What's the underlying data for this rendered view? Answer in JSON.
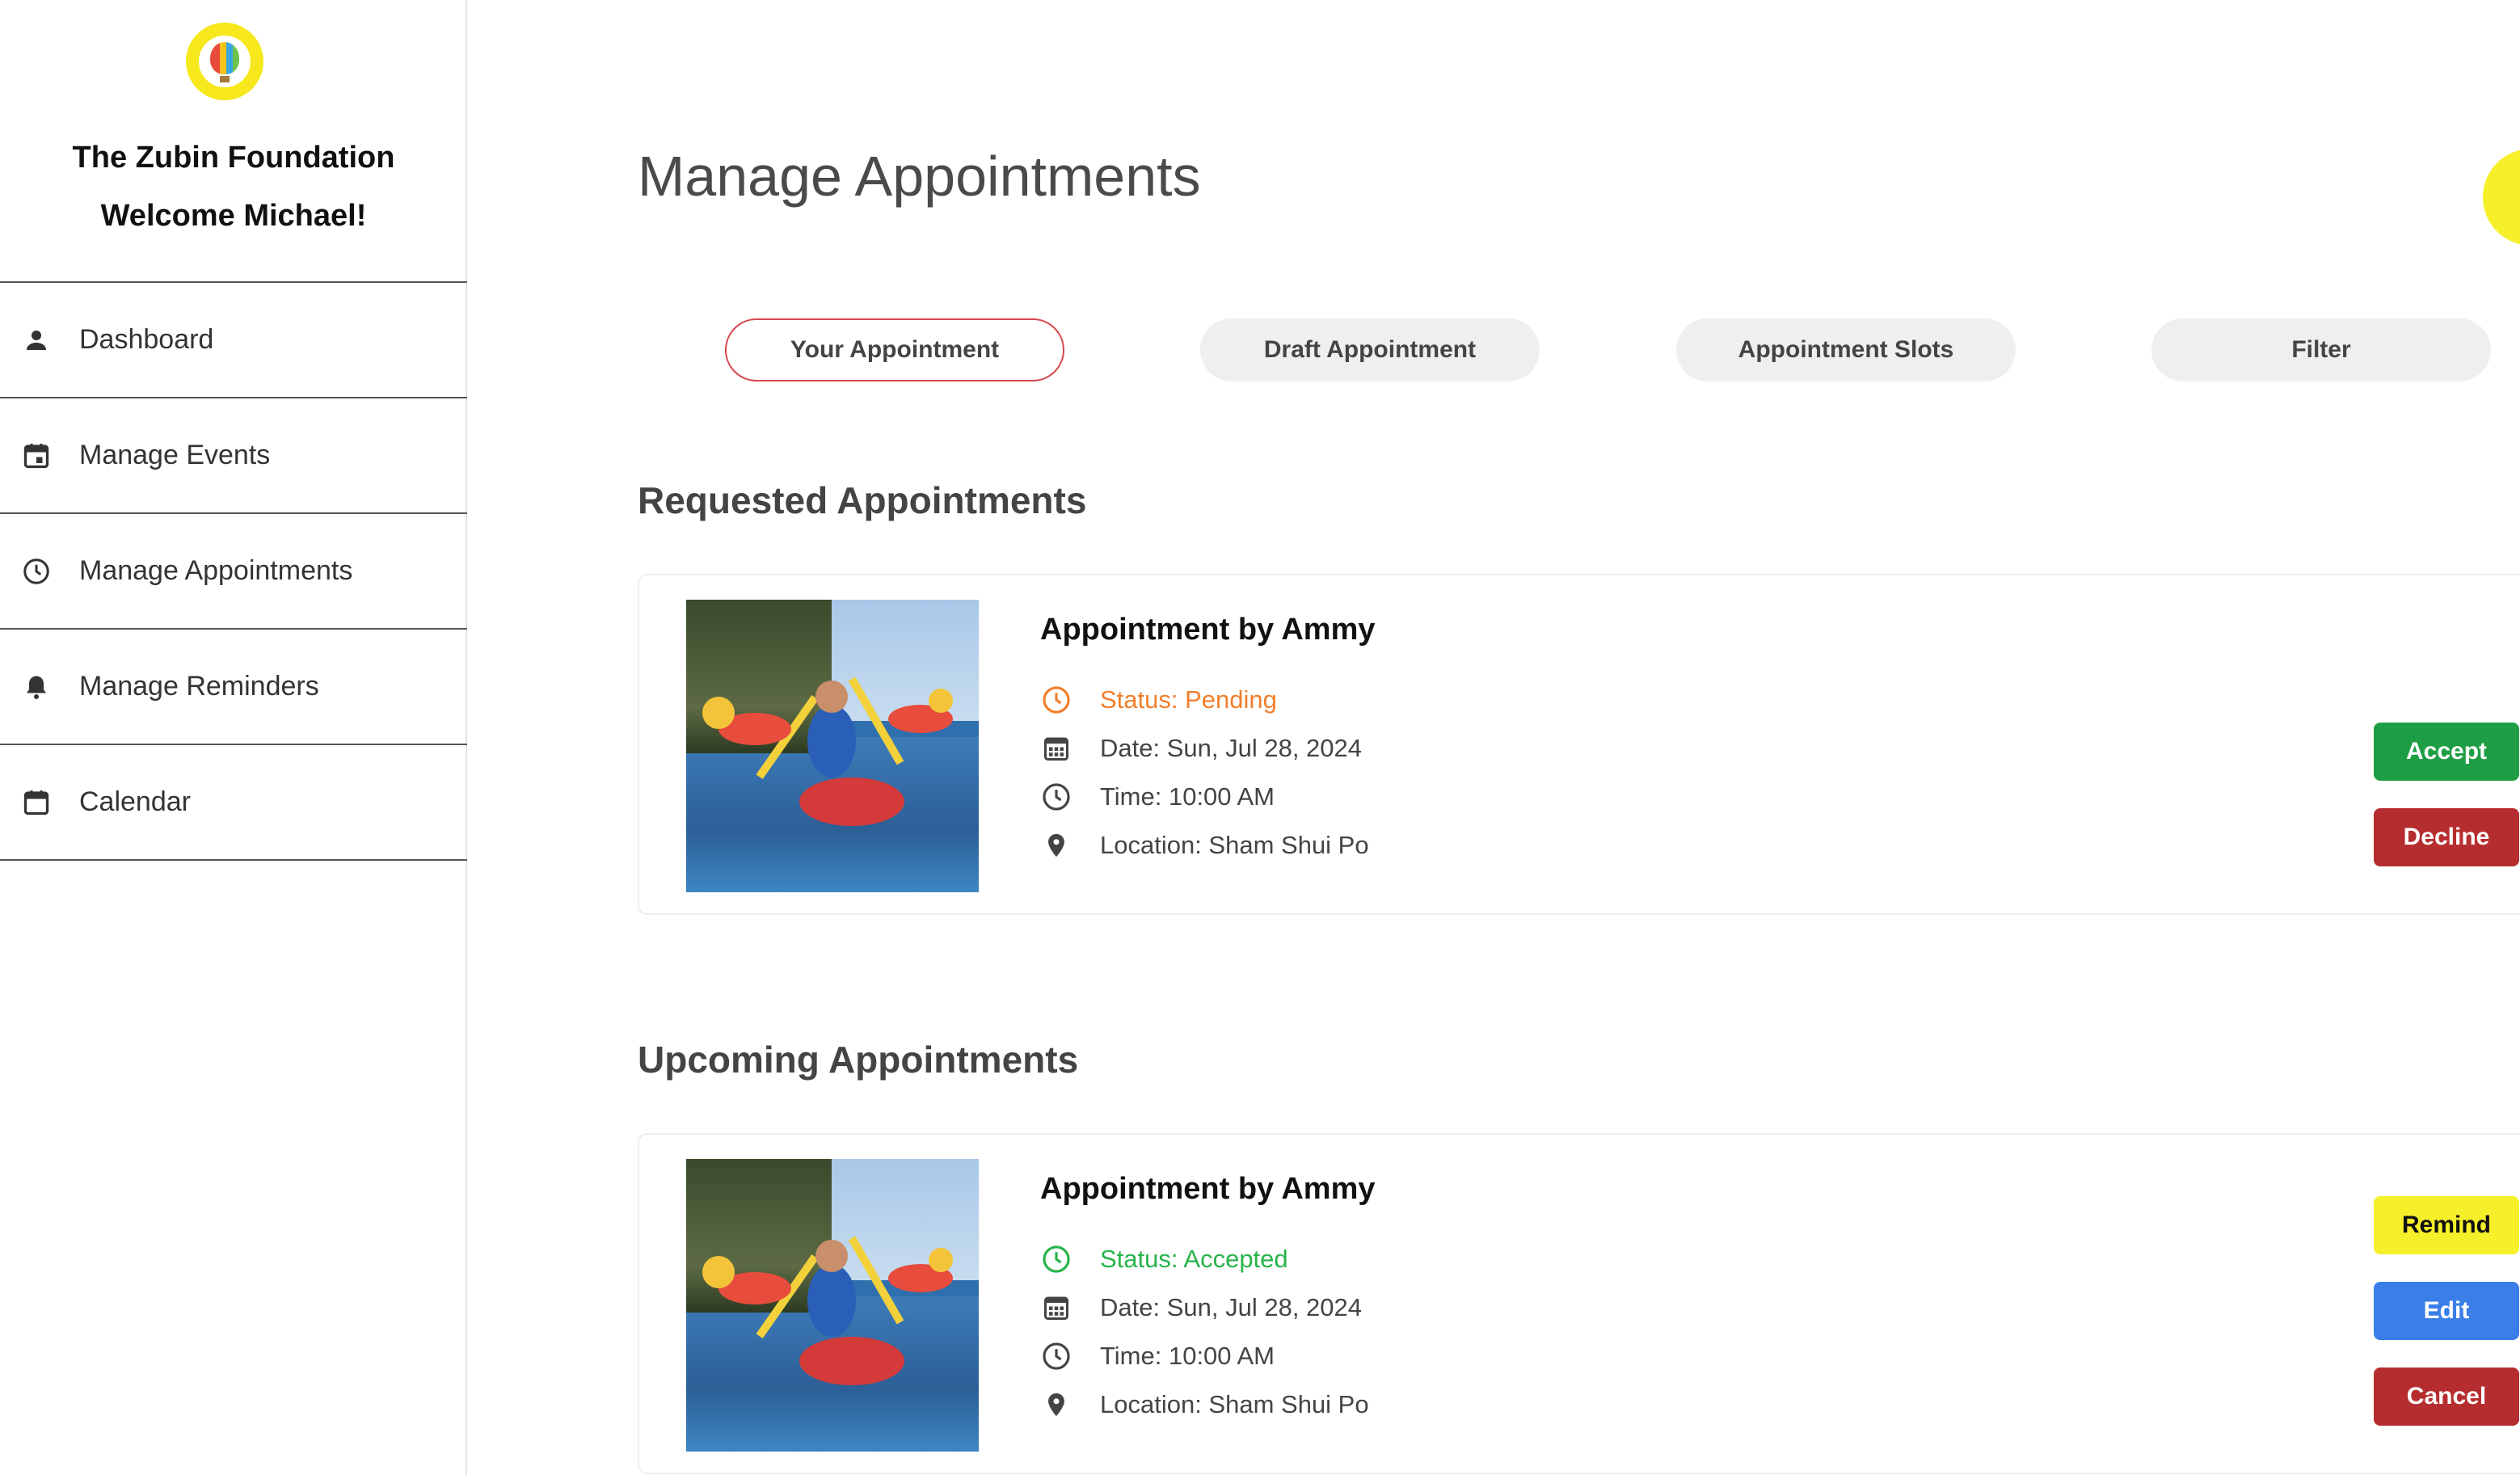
{
  "app": {
    "org_name": "The Zubin Foundation",
    "welcome": "Welcome Michael!",
    "logo_text": "The Zubin Foundation"
  },
  "sidebar": {
    "items": [
      {
        "label": "Dashboard",
        "icon": "person-icon"
      },
      {
        "label": "Manage Events",
        "icon": "calendar-event-icon"
      },
      {
        "label": "Manage Appointments",
        "icon": "clock-icon"
      },
      {
        "label": "Manage Reminders",
        "icon": "bell-icon"
      },
      {
        "label": "Calendar",
        "icon": "calendar-icon"
      }
    ]
  },
  "main": {
    "title": "Manage Appointments",
    "tabs": [
      {
        "label": "Your Appointment",
        "active": true
      },
      {
        "label": "Draft Appointment",
        "active": false
      },
      {
        "label": "Appointment Slots",
        "active": false
      },
      {
        "label": "Filter",
        "active": false
      }
    ],
    "requested": {
      "section_title": "Requested Appointments",
      "card": {
        "title": "Appointment by Ammy",
        "status": "Status: Pending",
        "date": "Date: Sun, Jul 28, 2024",
        "time": "Time: 10:00 AM",
        "location": "Location: Sham Shui Po",
        "image": "kayaking-photo",
        "accept_label": "Accept",
        "decline_label": "Decline"
      }
    },
    "upcoming": {
      "section_title": "Upcoming Appointments",
      "card": {
        "title": "Appointment by Ammy",
        "status": "Status: Accepted",
        "date": "Date: Sun, Jul 28, 2024",
        "time": "Time: 10:00 AM",
        "location": "Location: Sham Shui Po",
        "image": "kayaking-photo",
        "remind_label": "Remind",
        "edit_label": "Edit",
        "cancel_label": "Cancel"
      }
    }
  },
  "colors": {
    "pending": "#f07f2c",
    "accepted": "#28b34a",
    "accept": "#1e9e44",
    "decline": "#b62d2f",
    "remind": "#f6f02a",
    "edit": "#3a7ee8",
    "active_tab_border": "#d8454c"
  }
}
